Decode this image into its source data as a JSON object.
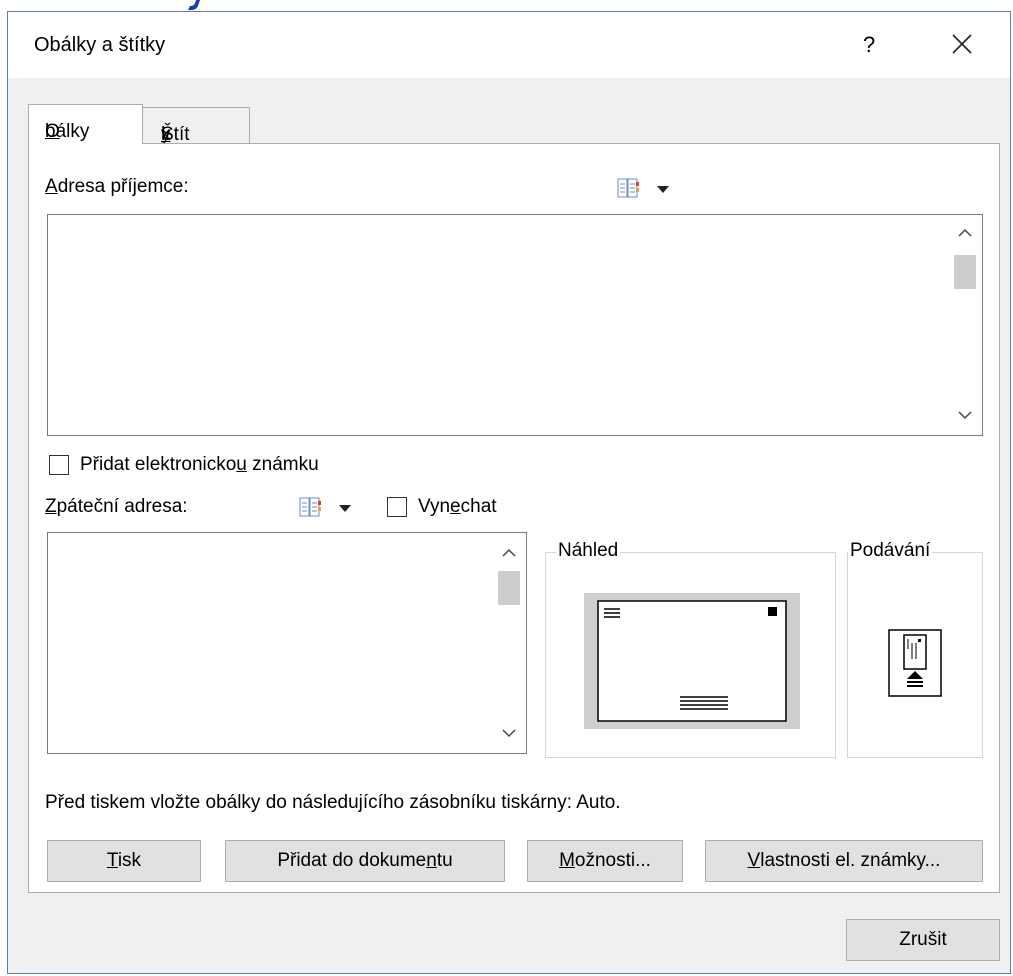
{
  "window": {
    "title": "Obálky a štítky",
    "help": "?"
  },
  "tabs": [
    {
      "label_u": "O",
      "label_rest": "bálky",
      "active": true
    },
    {
      "label_pre": "Štít",
      "label_u": "k",
      "label_post": "y",
      "active": false
    }
  ],
  "recipient": {
    "label_u": "A",
    "label_rest": "dresa příjemce:",
    "value": ""
  },
  "epostage": {
    "label_pre": "Přidat elektronicko",
    "label_u": "u",
    "label_post": " známku",
    "checked": false
  },
  "return_address": {
    "label_u": "Z",
    "label_rest": "páteční adresa:",
    "value": "",
    "omit_pre": "Vyn",
    "omit_u": "e",
    "omit_post": "chat",
    "omit_checked": false
  },
  "preview": {
    "label": "Náhled"
  },
  "feed": {
    "label": "Podávání"
  },
  "info_text": "Před tiskem vložte obálky do následujícího zásobníku tiskárny: Auto.",
  "buttons": {
    "print_u": "T",
    "print_rest": "isk",
    "add_pre": "Přidat do dokume",
    "add_u": "n",
    "add_post": "tu",
    "options_u": "M",
    "options_rest": "ožnosti...",
    "epostage_u": "V",
    "epostage_rest": "lastnosti el. známky...",
    "cancel": "Zrušit"
  },
  "icons": {
    "address_book": "address-book-icon",
    "dropdown": "chevron-down-icon",
    "close": "close-icon"
  },
  "colors": {
    "dialog_border": "#5b7fb0",
    "button_bg": "#e1e1e1",
    "scroll_thumb": "#cdcdcd"
  }
}
